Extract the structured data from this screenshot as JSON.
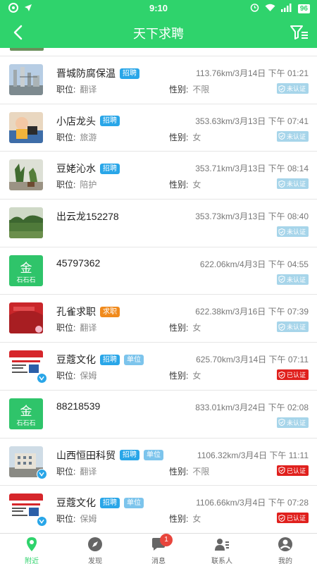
{
  "status_bar": {
    "time": "9:10",
    "battery": "96"
  },
  "header": {
    "title": "天下求聘"
  },
  "field_labels": {
    "position": "职位:",
    "gender": "性别:"
  },
  "rows": [
    {
      "name": "晋城防腐保温",
      "tags": [
        "招聘"
      ],
      "meta": "113.76km/3月14日 下午 01:21",
      "position": "翻译",
      "gender": "不限",
      "badge": "未认证",
      "thumb": "factory",
      "vip": false
    },
    {
      "name": "小店龙头",
      "tags": [
        "招聘"
      ],
      "meta": "353.63km/3月13日 下午 07:41",
      "position": "旅游",
      "gender": "女",
      "badge": "未认证",
      "thumb": "child",
      "vip": false
    },
    {
      "name": "豆姥沁水",
      "tags": [
        "招聘"
      ],
      "meta": "353.71km/3月13日 下午 08:14",
      "position": "陪护",
      "gender": "女",
      "badge": "未认证",
      "thumb": "plants",
      "vip": false
    },
    {
      "name": "出云龙152278",
      "tags": [],
      "meta": "353.73km/3月13日 下午 08:40",
      "position": "",
      "gender": "",
      "badge": "未认证",
      "thumb": "landscape",
      "vip": false
    },
    {
      "name": "45797362",
      "tags": [],
      "meta": "622.06km/4月3日 下午 04:55",
      "position": "",
      "gender": "",
      "badge": "未认证",
      "thumb": "logo",
      "vip": false
    },
    {
      "name": "孔雀求职",
      "tags": [
        "求职"
      ],
      "meta": "622.38km/3月16日 下午 07:39",
      "position": "翻译",
      "gender": "女",
      "badge": "未认证",
      "thumb": "red",
      "vip": false
    },
    {
      "name": "豆蔻文化",
      "tags": [
        "招聘",
        "单位"
      ],
      "meta": "625.70km/3月14日 下午 07:11",
      "position": "保姆",
      "gender": "女",
      "badge": "已认证",
      "thumb": "flyer",
      "vip": true
    },
    {
      "name": "88218539",
      "tags": [],
      "meta": "833.01km/3月24日 下午 02:08",
      "position": "",
      "gender": "",
      "badge": "未认证",
      "thumb": "logo",
      "vip": false
    },
    {
      "name": "山西恒田科贸",
      "tags": [
        "招聘",
        "单位"
      ],
      "meta": "1106.32km/3月4日 下午 11:11",
      "position": "翻译",
      "gender": "不限",
      "badge": "已认证",
      "thumb": "building",
      "vip": true
    },
    {
      "name": "豆蔻文化",
      "tags": [
        "招聘",
        "单位"
      ],
      "meta": "1106.66km/3月4日 下午 07:28",
      "position": "保姆",
      "gender": "女",
      "badge": "已认证",
      "thumb": "flyer",
      "vip": true
    }
  ],
  "tabbar": {
    "items": [
      {
        "label": "附近",
        "icon": "location-pin-icon",
        "active": true
      },
      {
        "label": "发现",
        "icon": "compass-icon",
        "active": false
      },
      {
        "label": "消息",
        "icon": "chat-bubble-icon",
        "active": false,
        "unread": "1"
      },
      {
        "label": "联系人",
        "icon": "contacts-icon",
        "active": false
      },
      {
        "label": "我的",
        "icon": "profile-icon",
        "active": false
      }
    ]
  },
  "colors": {
    "brand_green": "#2fd36c",
    "tag_blue": "#29a6e8",
    "tag_orange": "#f08a1c",
    "verified_red": "#e0201d",
    "unverified_blue": "#a7d5ea"
  }
}
